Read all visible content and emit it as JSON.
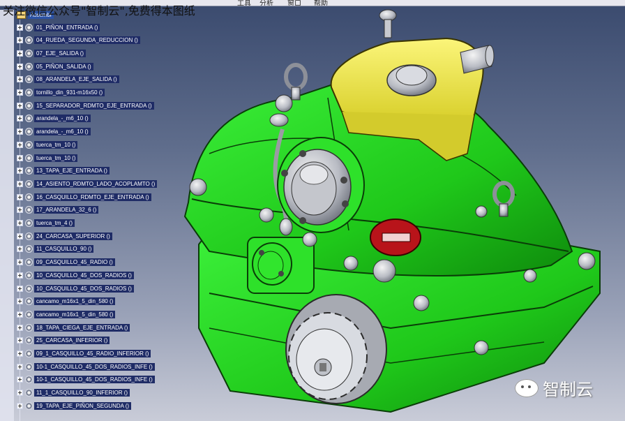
{
  "menubar": {
    "items": [
      "工具",
      "分析",
      "窗口",
      "帮助"
    ]
  },
  "watermark": "关注微信公众号\"智制云\",免费得本图纸",
  "tree": {
    "root_label": "Assembl",
    "items": [
      "01_PIÑON_ENTRADA ()",
      "04_RUEDA_SEGUNDA_REDUCCION ()",
      "07_EJE_SALIDA ()",
      "05_PIÑON_SALIDA ()",
      "08_ARANDELA_EJE_SALIDA ()",
      "tornillo_din_931-m16x50 ()",
      "15_SEPARADOR_RDMTO_EJE_ENTRADA ()",
      "arandela_-_m6_10 ()",
      "arandela_-_m6_10 ()",
      "tuerca_tm_10 ()",
      "tuerca_tm_10 ()",
      "13_TAPA_EJE_ENTRADA ()",
      "14_ASIENTO_RDMTO_LADO_ACOPLAMTO ()",
      "16_CASQUILLO_RDMTO_EJE_ENTRADA ()",
      "17_ARANDELA_32_6 ()",
      "tuerca_tm_4 ()",
      "24_CARCASA_SUPERIOR ()",
      "11_CASQUILLO_90 ()",
      "09_CASQUILLO_45_RADIO ()",
      "10_CASQUILLO_45_DOS_RADIOS ()",
      "10_CASQUILLO_45_DOS_RADIOS ()",
      "cancamo_m16x1_5_din_580 ()",
      "cancamo_m16x1_5_din_580 ()",
      "18_TAPA_CIEGA_EJE_ENTRADA ()",
      "25_CARCASA_INFERIOR ()",
      "09_1_CASQUILLO_45_RADIO_INFERIOR ()",
      "10-1_CASQUILLO_45_DOS_RADIOS_INFE ()",
      "10-1_CASQUILLO_45_DOS_RADIOS_INFE ()",
      "11_1_CASQUILLO_90_INFERIOR ()",
      "19_TAPA_EJE_PIÑON_SEGUNDA ()"
    ]
  },
  "brand": {
    "name": "智制云",
    "icon": "wechat-icon"
  },
  "colors": {
    "housing_green": "#22d11e",
    "cover_yellow": "#f0e84a",
    "background_top": "#3a4a6e",
    "selection_blue": "#1f2c66"
  }
}
